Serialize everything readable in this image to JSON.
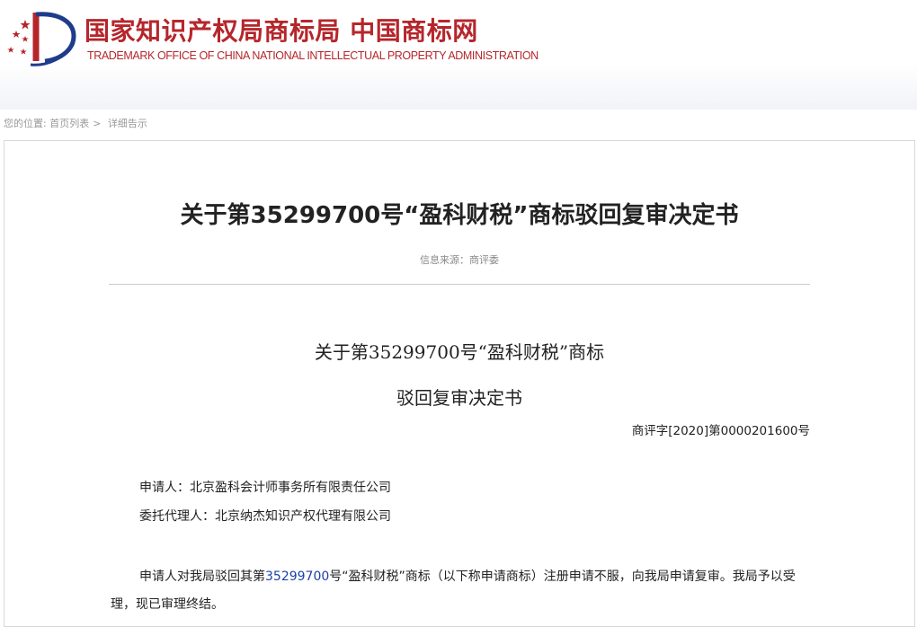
{
  "header": {
    "title": "国家知识产权局商标局 中国商标网",
    "subtitle": "TRADEMARK OFFICE OF CHINA NATIONAL INTELLECTUAL PROPERTY ADMINISTRATION",
    "brand_color": "#b5262b"
  },
  "breadcrumb": {
    "label": "您的位置:",
    "items": [
      "首页列表",
      "详细告示"
    ],
    "separator": ">"
  },
  "article": {
    "title": "关于第35299700号“盈科财税”商标驳回复审决定书",
    "source": "信息来源：商评委",
    "doc_heading_line1": "关于第35299700号“盈科财税”商标",
    "doc_heading_line2": "驳回复审决定书",
    "doc_number": "商评字[2020]第0000201600号",
    "applicant": "申请人：北京盈科会计师事务所有限责任公司",
    "agent": "委托代理人：北京纳杰知识产权代理有限公司",
    "body_before": "申请人对我局驳回其第",
    "body_number": "35299700",
    "body_after": "号“盈科财税”商标（以下称申请商标）注册申请不服，向我局申请复审。我局予以受理，现已审理终结。",
    "link_color": "#1e3fa8"
  }
}
